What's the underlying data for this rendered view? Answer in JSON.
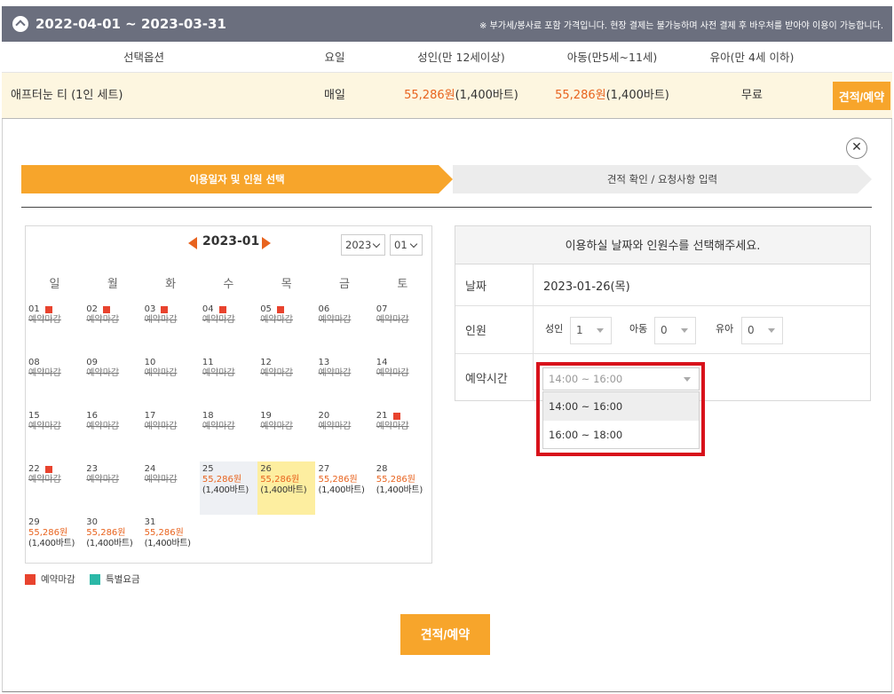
{
  "header": {
    "range": "2022-04-01 ~ 2023-03-31",
    "notice": "※ 부가세/봉사료 포함 가격입니다. 현장 결제는 불가능하며 사전 결제 후 바우처를 받아야 이용이 가능합니다."
  },
  "options_table": {
    "headers": [
      "선택옵션",
      "요일",
      "성인(만 12세이상)",
      "아동(만5세~11세)",
      "유아(만 4세 이하)"
    ],
    "row": {
      "name": "애프터눈 티 (1인 세트)",
      "day": "매일",
      "adult_price": "55,286원",
      "adult_baht": "(1,400바트)",
      "child_price": "55,286원",
      "child_baht": "(1,400바트)",
      "infant": "무료",
      "button": "견적/예약"
    }
  },
  "close_icon": "✕",
  "steps": {
    "step1": "이용일자 및 인원 선택",
    "step2": "견적 확인 / 요청사항 입력"
  },
  "calendar": {
    "title": "2023-01",
    "year_select": "2023",
    "month_select": "01",
    "weekdays": [
      "일",
      "월",
      "화",
      "수",
      "목",
      "금",
      "토"
    ],
    "first_weekday_index": 0,
    "days": [
      {
        "num": "01",
        "mark": true,
        "status": "예약마감"
      },
      {
        "num": "02",
        "mark": true,
        "status": "예약마감"
      },
      {
        "num": "03",
        "mark": true,
        "status": "예약마감"
      },
      {
        "num": "04",
        "mark": true,
        "status": "예약마감"
      },
      {
        "num": "05",
        "mark": true,
        "status": "예약마감"
      },
      {
        "num": "06",
        "mark": false,
        "status": "예약마감"
      },
      {
        "num": "07",
        "mark": false,
        "status": "예약마감"
      },
      {
        "num": "08",
        "mark": false,
        "status": "예약마감"
      },
      {
        "num": "09",
        "mark": false,
        "status": "예약마감"
      },
      {
        "num": "10",
        "mark": false,
        "status": "예약마감"
      },
      {
        "num": "11",
        "mark": false,
        "status": "예약마감"
      },
      {
        "num": "12",
        "mark": false,
        "status": "예약마감"
      },
      {
        "num": "13",
        "mark": false,
        "status": "예약마감"
      },
      {
        "num": "14",
        "mark": false,
        "status": "예약마감"
      },
      {
        "num": "15",
        "mark": false,
        "status": "예약마감"
      },
      {
        "num": "16",
        "mark": false,
        "status": "예약마감"
      },
      {
        "num": "17",
        "mark": false,
        "status": "예약마감"
      },
      {
        "num": "18",
        "mark": false,
        "status": "예약마감"
      },
      {
        "num": "19",
        "mark": false,
        "status": "예약마감"
      },
      {
        "num": "20",
        "mark": false,
        "status": "예약마감"
      },
      {
        "num": "21",
        "mark": true,
        "status": "예약마감"
      },
      {
        "num": "22",
        "mark": true,
        "status": "예약마감"
      },
      {
        "num": "23",
        "mark": false,
        "status": "예약마감"
      },
      {
        "num": "24",
        "mark": false,
        "status": "예약마감"
      },
      {
        "num": "25",
        "mark": false,
        "price": "55,286원",
        "baht": "(1,400바트)",
        "highlight": "gray"
      },
      {
        "num": "26",
        "mark": false,
        "price": "55,286원",
        "baht": "(1,400바트)",
        "highlight": "yellow"
      },
      {
        "num": "27",
        "mark": false,
        "price": "55,286원",
        "baht": "(1,400바트)"
      },
      {
        "num": "28",
        "mark": false,
        "price": "55,286원",
        "baht": "(1,400바트)"
      },
      {
        "num": "29",
        "mark": false,
        "price": "55,286원",
        "baht": "(1,400바트)"
      },
      {
        "num": "30",
        "mark": false,
        "price": "55,286원",
        "baht": "(1,400바트)"
      },
      {
        "num": "31",
        "mark": false,
        "price": "55,286원",
        "baht": "(1,400바트)"
      }
    ],
    "legend": [
      {
        "label": "예약마감",
        "color": "#e8432e"
      },
      {
        "label": "특별요금",
        "color": "#2bb8a7"
      }
    ]
  },
  "booking": {
    "title": "이용하실 날짜와 인원수를 선택해주세요.",
    "date_label": "날짜",
    "date_value": "2023-01-26(목)",
    "people_label": "인원",
    "adult_label": "성인",
    "adult_value": "1",
    "child_label": "아동",
    "child_value": "0",
    "infant_label": "유아",
    "infant_value": "0",
    "time_label": "예약시간",
    "time_selected": "14:00 ~ 16:00",
    "time_options": [
      "14:00 ~ 16:00",
      "16:00 ~ 18:00"
    ]
  },
  "main_button": "견적/예약",
  "colors": {
    "accent": "#f7a52b",
    "price": "#e8631e",
    "header_bg": "#6b6f7e",
    "highlight_box": "#d8121b"
  }
}
